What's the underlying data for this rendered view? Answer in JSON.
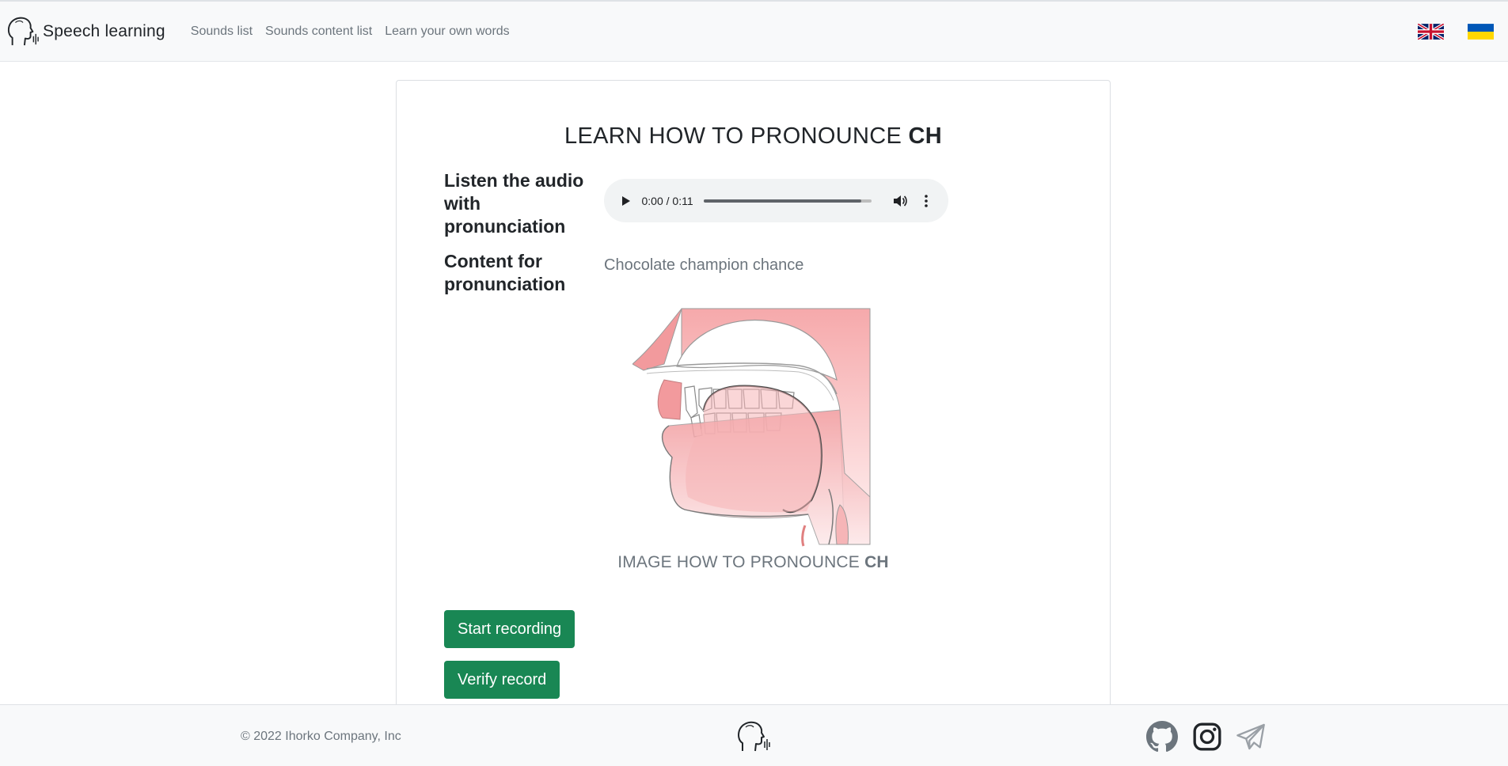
{
  "navbar": {
    "brand": "Speech learning",
    "links": [
      "Sounds list",
      "Sounds content list",
      "Learn your own words"
    ],
    "flags": [
      "english-flag",
      "ukrainian-flag"
    ]
  },
  "main": {
    "title_prefix": "LEARN HOW TO PRONOUNCE",
    "sound": "CH",
    "audio_label": "Listen the audio with pronunciation",
    "audio": {
      "time": "0:00 / 0:11"
    },
    "content_label": "Content for pronunciation",
    "content_text": "Chocolate champion chance",
    "image_caption_prefix": "IMAGE HOW TO PRONOUNCE",
    "start_button": "Start recording",
    "verify_button": "Verify record"
  },
  "footer": {
    "copyright": "© 2022 Ihorko Company, Inc",
    "icons": [
      "github-icon",
      "instagram-icon",
      "telegram-icon"
    ]
  },
  "colors": {
    "success": "#198754",
    "muted": "#6c757d",
    "navbar_bg": "#f8f9fa",
    "diagram_pink": "#f2a0a3"
  }
}
